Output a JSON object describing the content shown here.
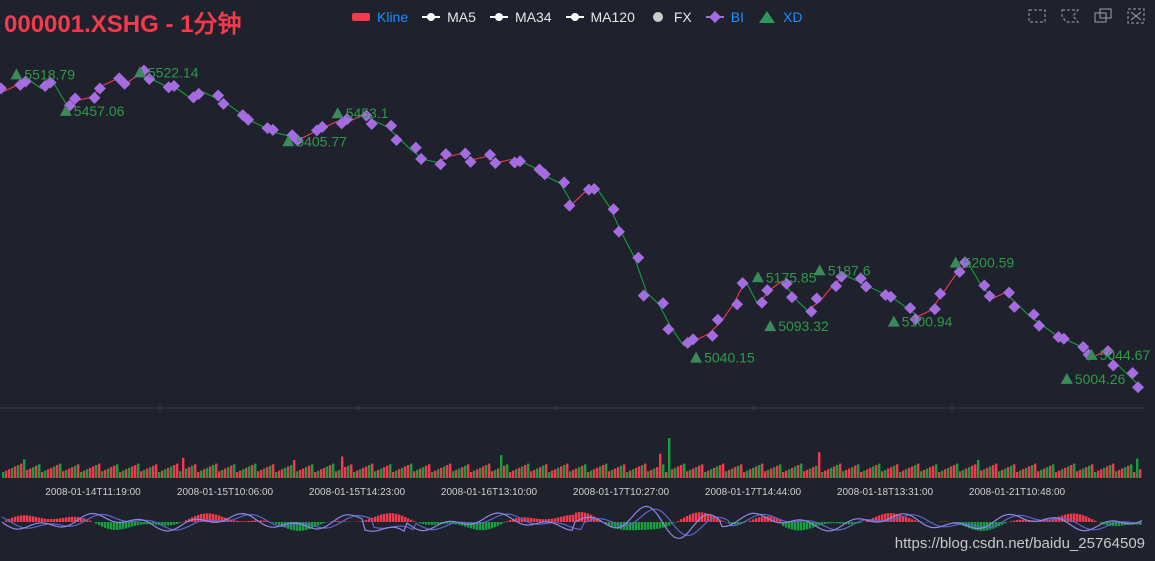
{
  "title": "000001.XSHG - 1分钟",
  "legend": [
    {
      "label": "Kline",
      "color": "#f33a4d",
      "text_color": "#1890ff",
      "icon": "rect-icon"
    },
    {
      "label": "MA5",
      "color": "#ffffff",
      "text_color": "#e6e6e6",
      "icon": "line-dot-icon"
    },
    {
      "label": "MA34",
      "color": "#ffffff",
      "text_color": "#e6e6e6",
      "icon": "line-dot-icon"
    },
    {
      "label": "MA120",
      "color": "#ffffff",
      "text_color": "#e6e6e6",
      "icon": "line-dot-icon"
    },
    {
      "label": "FX",
      "color": "#cccccc",
      "text_color": "#e6e6e6",
      "icon": "circle-icon"
    },
    {
      "label": "BI",
      "color": "#a56be0",
      "text_color": "#1890ff",
      "icon": "line-diamond-icon"
    },
    {
      "label": "XD",
      "color": "#2a9a5a",
      "text_color": "#1890ff",
      "icon": "triangle-icon"
    }
  ],
  "toolbox": [
    "zoom-area-icon",
    "lasso-icon",
    "restore-icon",
    "clear-select-icon"
  ],
  "watermark": "https://blog.csdn.net/baidu_25764509",
  "colors": {
    "background": "#1f212d",
    "up": "#f33a4d",
    "down": "#14a03c",
    "bi": "#a56be0",
    "xd_marker": "#3a8a5c",
    "xd_label": "#2f9a48",
    "axis_label": "#cfcfcf",
    "macd_dif": "#8f86e6",
    "macd_dea": "#5a66c8"
  },
  "chart_data": {
    "type": "line",
    "price_range": [
      4960,
      5560
    ],
    "x_tick_labels": [
      "2008-01-14T11:19:00",
      "2008-01-15T10:06:00",
      "2008-01-15T14:23:00",
      "2008-01-16T13:10:00",
      "2008-01-17T10:27:00",
      "2008-01-17T14:44:00",
      "2008-01-18T13:31:00",
      "2008-01-21T10:48:00"
    ],
    "price_path": [
      5490,
      5500,
      5510,
      5495,
      5505,
      5470,
      5475,
      5480,
      5500,
      5510,
      5505,
      5520,
      5510,
      5500,
      5495,
      5480,
      5490,
      5480,
      5470,
      5455,
      5440,
      5430,
      5420,
      5415,
      5410,
      5420,
      5430,
      5440,
      5440,
      5450,
      5440,
      5430,
      5410,
      5390,
      5375,
      5370,
      5380,
      5385,
      5375,
      5380,
      5370,
      5375,
      5370,
      5360,
      5345,
      5335,
      5300,
      5320,
      5325,
      5295,
      5250,
      5210,
      5150,
      5130,
      5090,
      5060,
      5070,
      5080,
      5100,
      5130,
      5170,
      5130,
      5155,
      5170,
      5140,
      5120,
      5135,
      5160,
      5180,
      5170,
      5160,
      5150,
      5140,
      5125,
      5110,
      5120,
      5150,
      5180,
      5200,
      5165,
      5140,
      5150,
      5130,
      5110,
      5095,
      5080,
      5070,
      5060,
      5040,
      5050,
      5030,
      5010,
      4990
    ],
    "xd_points": [
      {
        "label": "5518.79",
        "value": 5518.79,
        "index": 1
      },
      {
        "label": "5457.06",
        "value": 5457.06,
        "index": 5
      },
      {
        "label": "5522.14",
        "value": 5522.14,
        "index": 11
      },
      {
        "label": "5405.77",
        "value": 5405.77,
        "index": 23
      },
      {
        "label": "5453.1",
        "value": 5453.1,
        "index": 27
      },
      {
        "label": "5040.15",
        "value": 5040.15,
        "index": 56
      },
      {
        "label": "5175.85",
        "value": 5175.85,
        "index": 61
      },
      {
        "label": "5093.32",
        "value": 5093.32,
        "index": 62
      },
      {
        "label": "5187.6",
        "value": 5187.6,
        "index": 66
      },
      {
        "label": "5100.94",
        "value": 5100.94,
        "index": 72
      },
      {
        "label": "5200.59",
        "value": 5200.59,
        "index": 77
      },
      {
        "label": "5004.26",
        "value": 5004.26,
        "index": 86
      },
      {
        "label": "5044.67",
        "value": 5044.67,
        "index": 88
      }
    ]
  }
}
